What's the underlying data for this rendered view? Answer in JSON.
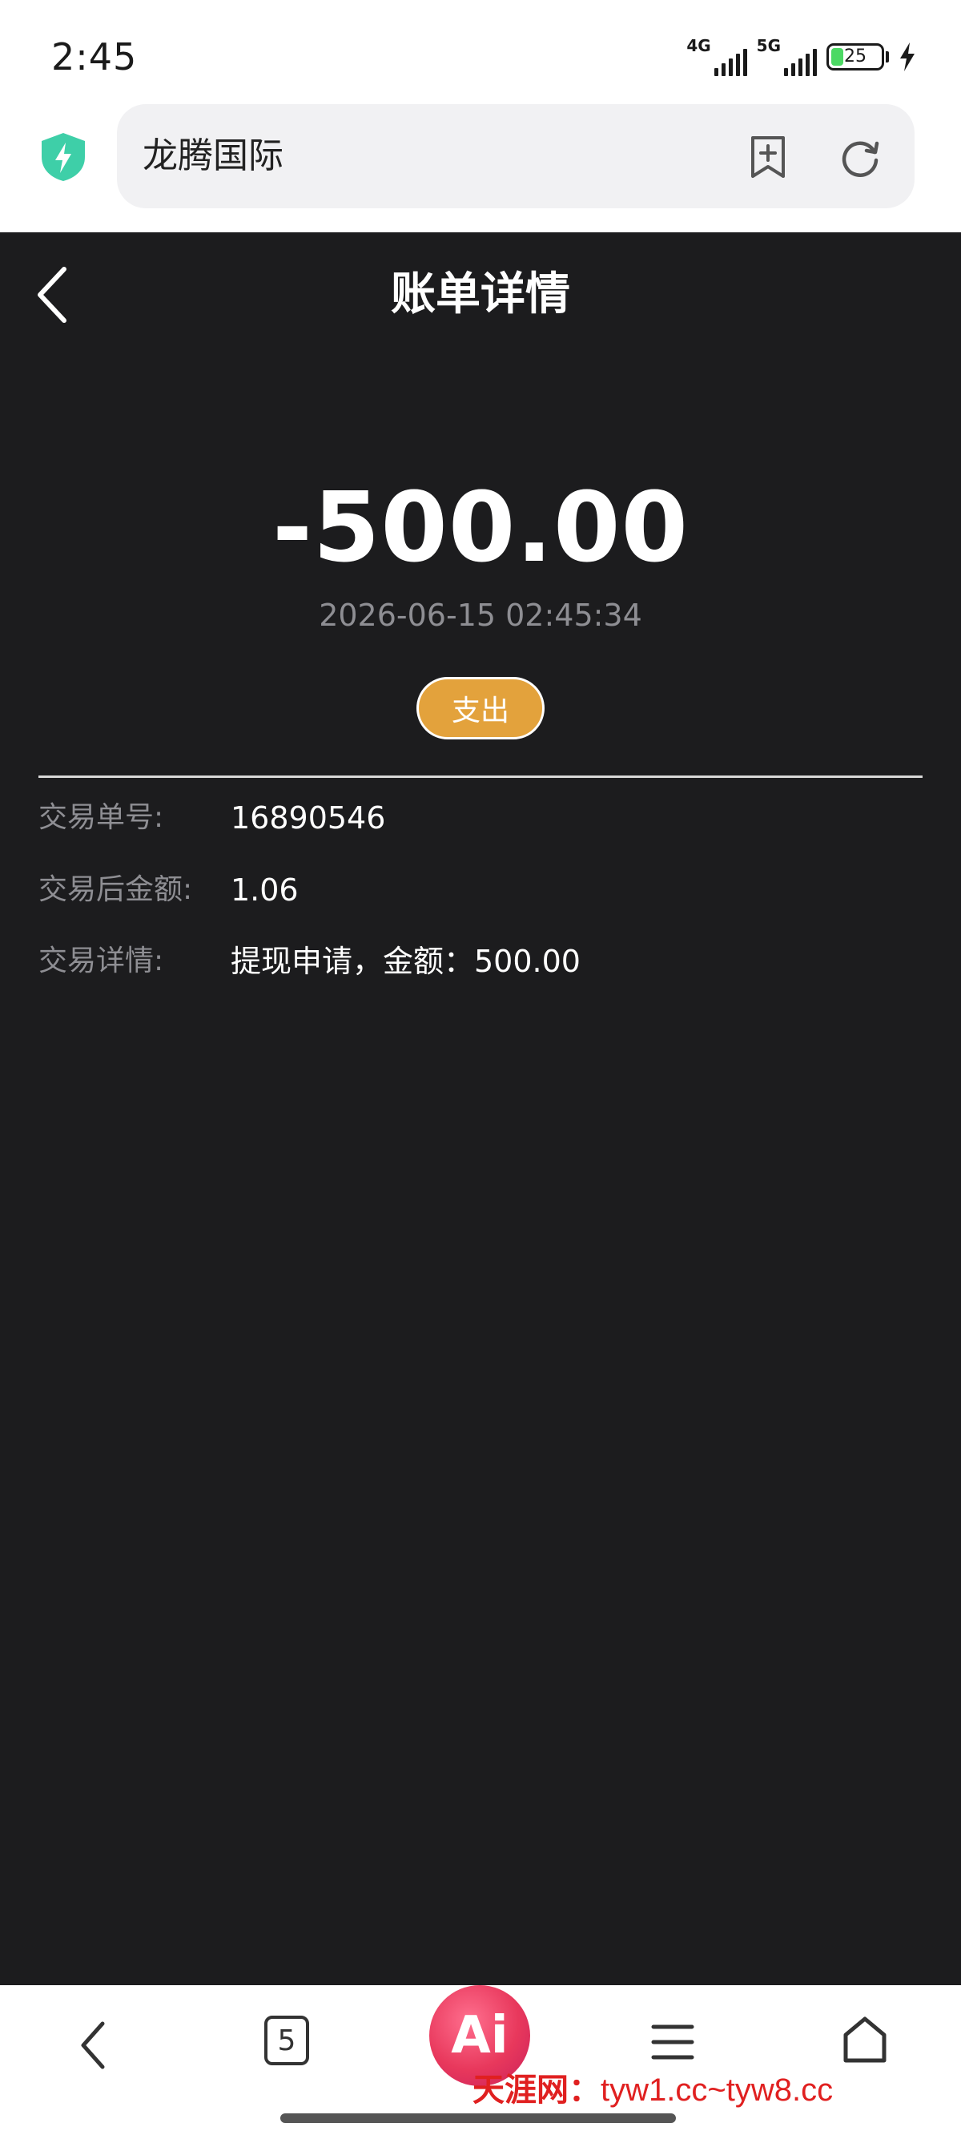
{
  "status_bar": {
    "time": "2:45",
    "network1": "4G",
    "network2": "5G",
    "battery_level": "25",
    "battery_fraction": 0.25,
    "battery_color": "#4cd964"
  },
  "browser": {
    "url_text": "龙腾国际",
    "shield_color": "#3ecfa8"
  },
  "page": {
    "title": "账单详情",
    "amount": "-500.00",
    "timestamp": "2026-06-15 02:45:34",
    "type_badge": "支出",
    "badge_color": "#e3a23c",
    "details": [
      {
        "label": "交易单号:",
        "value": "16890546"
      },
      {
        "label": "交易后金额:",
        "value": "1.06"
      },
      {
        "label": "交易详情:",
        "value": "提现申请，金额：500.00"
      }
    ]
  },
  "bottom_bar": {
    "tabs_count": "5",
    "ai_label": "Ai",
    "watermark_name": "天涯网：",
    "watermark_url": "tyw1.cc~tyw8.cc"
  },
  "icons": [
    "shield-icon",
    "bookmark-add-icon",
    "refresh-icon",
    "back-arrow-icon",
    "menu-icon",
    "home-icon"
  ]
}
